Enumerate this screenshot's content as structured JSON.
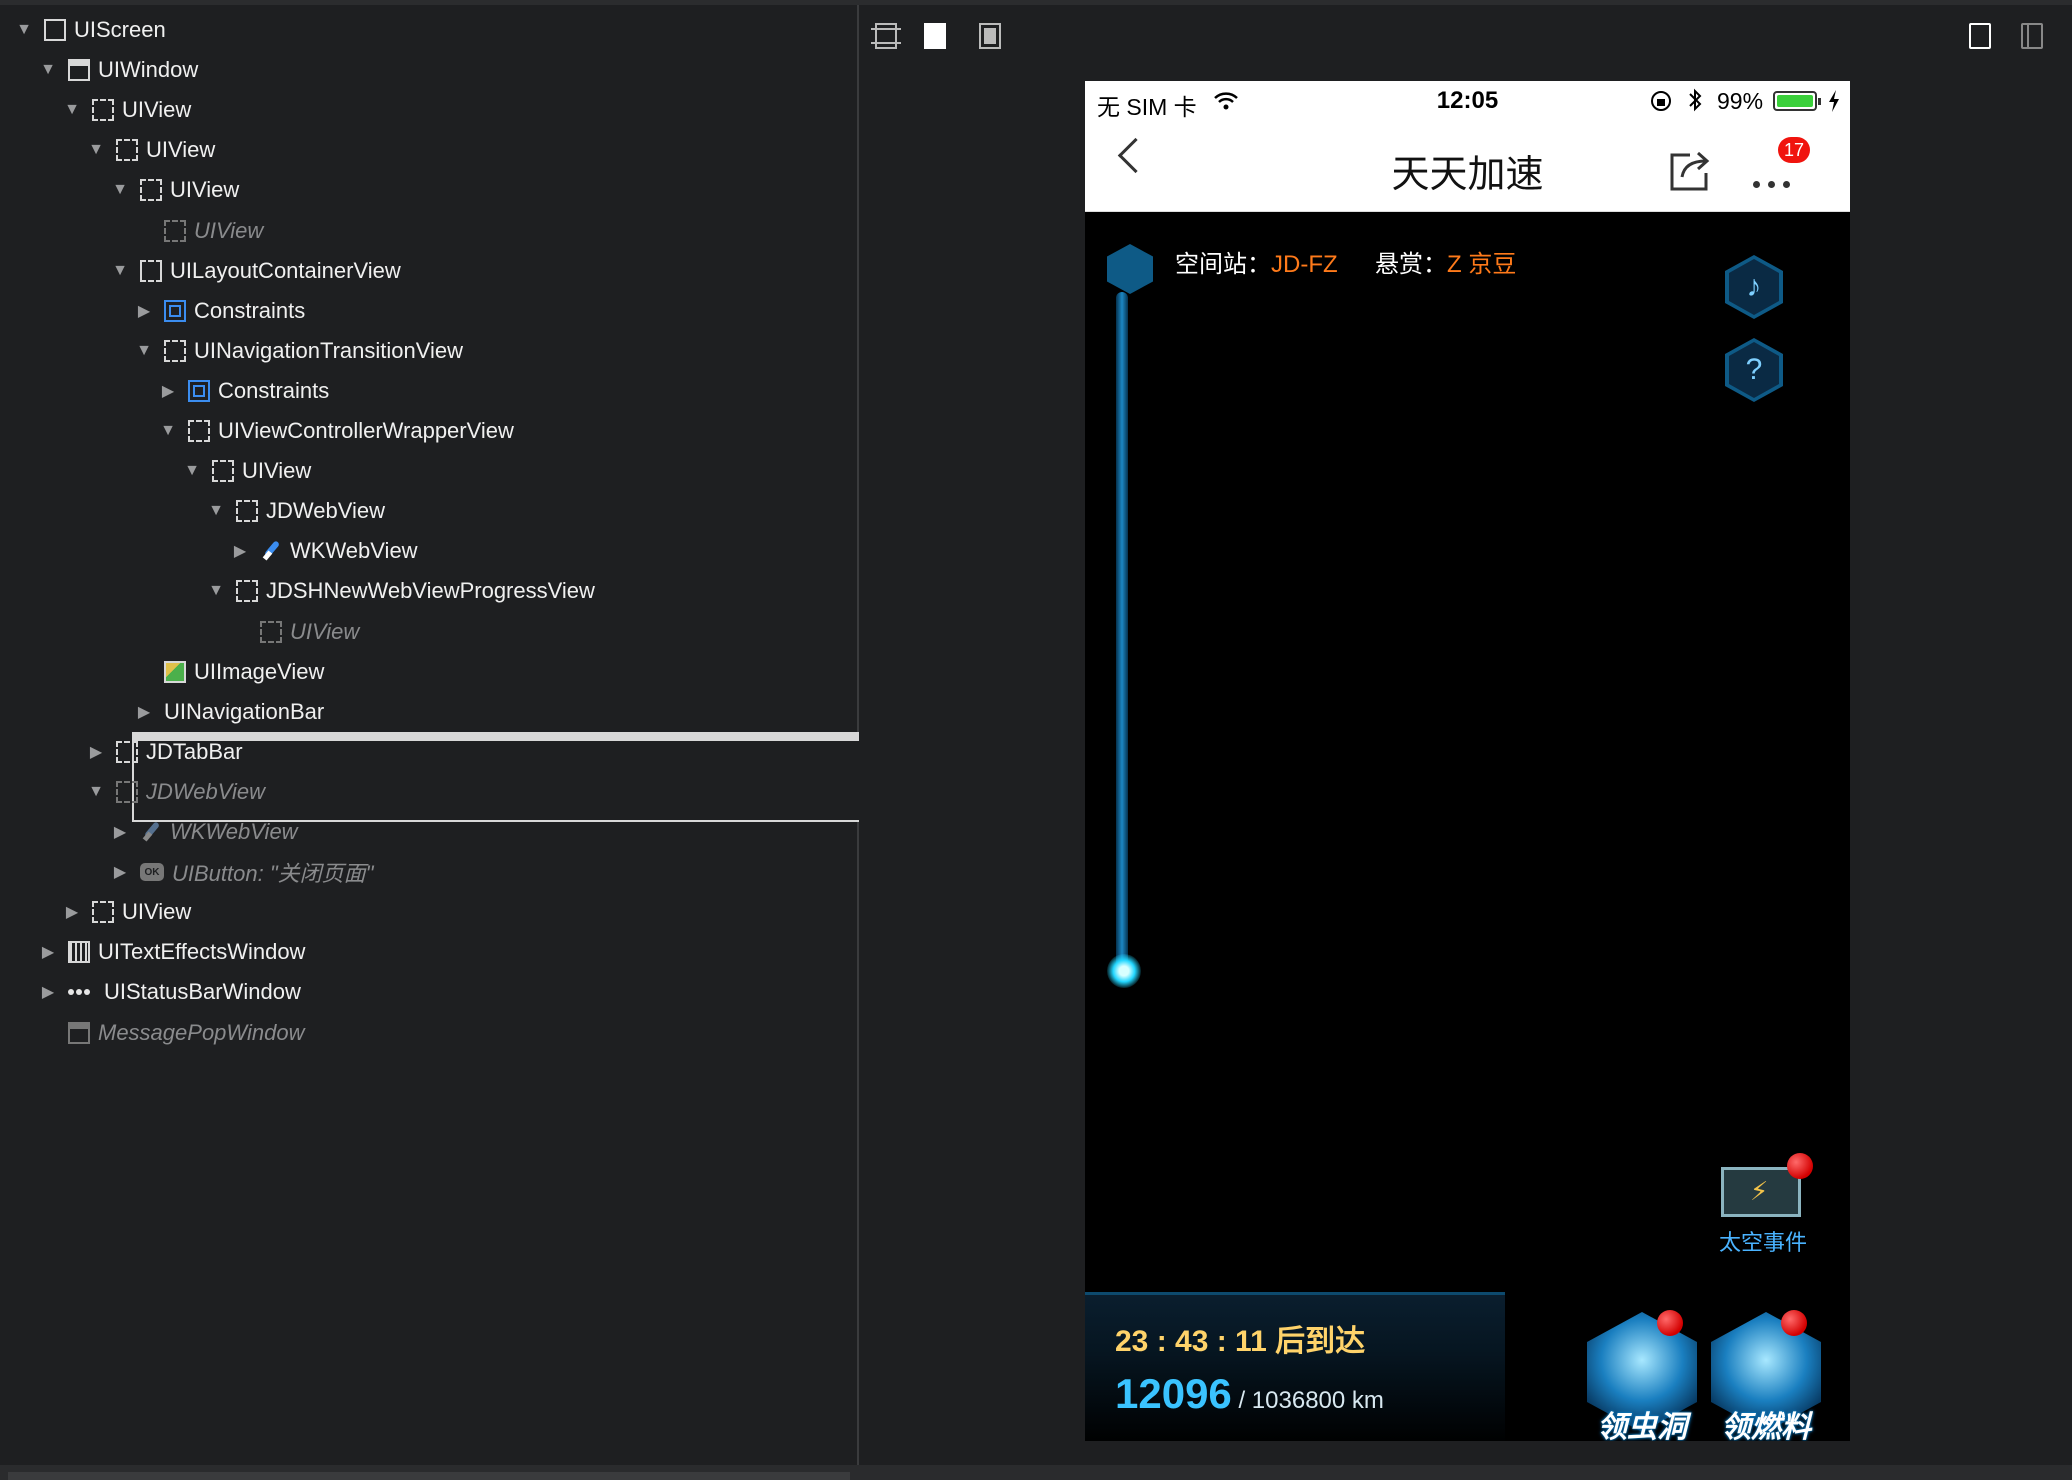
{
  "hierarchy": [
    {
      "label": "UIScreen",
      "indent": 0,
      "tri": "down",
      "icon": "screen",
      "dim": false
    },
    {
      "label": "UIWindow",
      "indent": 1,
      "tri": "down",
      "icon": "window",
      "dim": false
    },
    {
      "label": "UIView",
      "indent": 2,
      "tri": "down",
      "icon": "dash",
      "dim": false
    },
    {
      "label": "UIView",
      "indent": 3,
      "tri": "down",
      "icon": "dash",
      "dim": false
    },
    {
      "label": "UIView",
      "indent": 4,
      "tri": "down",
      "icon": "dash",
      "dim": false
    },
    {
      "label": "UIView",
      "indent": 5,
      "tri": "none",
      "icon": "dash",
      "dim": true
    },
    {
      "label": "UILayoutContainerView",
      "indent": 4,
      "tri": "down",
      "icon": "layout",
      "dim": false
    },
    {
      "label": "Constraints",
      "indent": 5,
      "tri": "right",
      "icon": "constraint",
      "dim": false
    },
    {
      "label": "UINavigationTransitionView",
      "indent": 5,
      "tri": "down",
      "icon": "dash",
      "dim": false
    },
    {
      "label": "Constraints",
      "indent": 6,
      "tri": "right",
      "icon": "constraint",
      "dim": false
    },
    {
      "label": "UIViewControllerWrapperView",
      "indent": 6,
      "tri": "down",
      "icon": "dash",
      "dim": false
    },
    {
      "label": "UIView",
      "indent": 7,
      "tri": "down",
      "icon": "dash",
      "dim": false
    },
    {
      "label": "JDWebView",
      "indent": 8,
      "tri": "down",
      "icon": "dash",
      "dim": false
    },
    {
      "label": "WKWebView",
      "indent": 9,
      "tri": "right",
      "icon": "compass",
      "dim": false
    },
    {
      "label": "JDSHNewWebViewProgressView",
      "indent": 8,
      "tri": "down",
      "icon": "dash",
      "dim": false
    },
    {
      "label": "UIView",
      "indent": 9,
      "tri": "none",
      "icon": "dash",
      "dim": true
    },
    {
      "label": "UIImageView",
      "indent": 5,
      "tri": "none",
      "icon": "image",
      "dim": false
    },
    {
      "label": "UINavigationBar",
      "indent": 5,
      "tri": "right",
      "icon": "navbar",
      "dim": false
    },
    {
      "label": "JDTabBar",
      "indent": 3,
      "tri": "right",
      "icon": "dash",
      "dim": false
    },
    {
      "label": "JDWebView",
      "indent": 3,
      "tri": "down",
      "icon": "dash",
      "dim": true
    },
    {
      "label": "WKWebView",
      "indent": 4,
      "tri": "right",
      "icon": "compass",
      "dim": true
    },
    {
      "label": "UIButton: \"关闭页面\"",
      "indent": 4,
      "tri": "right",
      "icon": "button",
      "dim": true
    },
    {
      "label": "UIView",
      "indent": 2,
      "tri": "right",
      "icon": "dash",
      "dim": false
    },
    {
      "label": "UITextEffectsWindow",
      "indent": 1,
      "tri": "right",
      "icon": "textwin",
      "dim": false
    },
    {
      "label": "UIStatusBarWindow",
      "indent": 1,
      "tri": "right",
      "icon": "dots",
      "dim": false
    },
    {
      "label": "MessagePopWindow",
      "indent": 1,
      "tri": "none",
      "icon": "window",
      "dim": true
    }
  ],
  "button_icon_text": "OK",
  "phone": {
    "status": {
      "carrier": "无 SIM 卡",
      "time": "12:05",
      "battery": "99%"
    },
    "navbar": {
      "title": "天天加速",
      "badge": "17"
    },
    "game": {
      "station_label": "空间站：",
      "station_value": "JD-FZ",
      "reward_label": "悬赏：",
      "reward_value": "Z 京豆",
      "music_glyph": "♪",
      "help_glyph": "?",
      "event_label": "太空事件",
      "countdown": "23 : 43 : 11 后到达",
      "distance_current": "12096",
      "distance_total": " / 1036800 km",
      "button_wormhole": "领虫洞",
      "button_fuel": "领燃料"
    }
  },
  "colors": {
    "accent_orange": "#ff7a1a",
    "event_blue": "#4ab3ff",
    "badge_red": "#f0140e"
  }
}
